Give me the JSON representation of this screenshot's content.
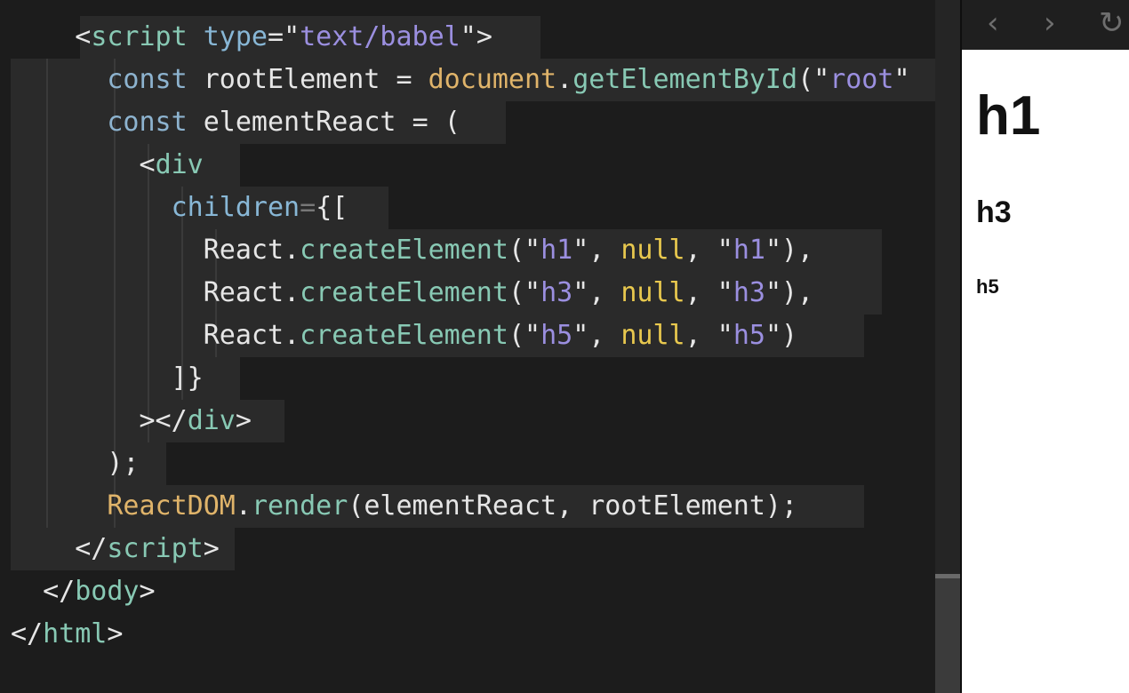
{
  "editor": {
    "lines": [
      {
        "indent": "    ",
        "tokens": [
          [
            "t-punc",
            "<"
          ],
          [
            "t-tag",
            "script"
          ],
          [
            "t-id",
            " "
          ],
          [
            "t-attr",
            "type"
          ],
          [
            "t-punc",
            "="
          ],
          [
            "t-punc",
            "\""
          ],
          [
            "t-str",
            "text/babel"
          ],
          [
            "t-punc",
            "\""
          ],
          [
            "t-punc",
            ">"
          ]
        ]
      },
      {
        "indent": "      ",
        "tokens": [
          [
            "t-kw",
            "const"
          ],
          [
            "t-id",
            " rootElement "
          ],
          [
            "t-punc",
            "="
          ],
          [
            "t-id",
            " "
          ],
          [
            "t-obj",
            "document"
          ],
          [
            "t-punc",
            "."
          ],
          [
            "t-fn",
            "getElementById"
          ],
          [
            "t-punc",
            "("
          ],
          [
            "t-punc",
            "\""
          ],
          [
            "t-str",
            "root"
          ],
          [
            "t-punc",
            "\""
          ]
        ]
      },
      {
        "indent": "      ",
        "tokens": [
          [
            "t-kw",
            "const"
          ],
          [
            "t-id",
            " elementReact "
          ],
          [
            "t-punc",
            "="
          ],
          [
            "t-id",
            " "
          ],
          [
            "t-punc",
            "("
          ]
        ]
      },
      {
        "indent": "        ",
        "tokens": [
          [
            "t-punc",
            "<"
          ],
          [
            "t-tag",
            "div"
          ]
        ]
      },
      {
        "indent": "          ",
        "tokens": [
          [
            "t-attr",
            "children"
          ],
          [
            "t-op",
            "="
          ],
          [
            "t-punc",
            "{["
          ]
        ]
      },
      {
        "indent": "            ",
        "tokens": [
          [
            "t-id",
            "React"
          ],
          [
            "t-punc",
            "."
          ],
          [
            "t-fn",
            "createElement"
          ],
          [
            "t-punc",
            "(\""
          ],
          [
            "t-str",
            "h1"
          ],
          [
            "t-punc",
            "\", "
          ],
          [
            "t-null",
            "null"
          ],
          [
            "t-punc",
            ", \""
          ],
          [
            "t-str",
            "h1"
          ],
          [
            "t-punc",
            "\"),"
          ]
        ]
      },
      {
        "indent": "            ",
        "tokens": [
          [
            "t-id",
            "React"
          ],
          [
            "t-punc",
            "."
          ],
          [
            "t-fn",
            "createElement"
          ],
          [
            "t-punc",
            "(\""
          ],
          [
            "t-str",
            "h3"
          ],
          [
            "t-punc",
            "\", "
          ],
          [
            "t-null",
            "null"
          ],
          [
            "t-punc",
            ", \""
          ],
          [
            "t-str",
            "h3"
          ],
          [
            "t-punc",
            "\"),"
          ]
        ]
      },
      {
        "indent": "            ",
        "tokens": [
          [
            "t-id",
            "React"
          ],
          [
            "t-punc",
            "."
          ],
          [
            "t-fn",
            "createElement"
          ],
          [
            "t-punc",
            "(\""
          ],
          [
            "t-str",
            "h5"
          ],
          [
            "t-punc",
            "\", "
          ],
          [
            "t-null",
            "null"
          ],
          [
            "t-punc",
            ", \""
          ],
          [
            "t-str",
            "h5"
          ],
          [
            "t-punc",
            "\")"
          ]
        ]
      },
      {
        "indent": "          ",
        "tokens": [
          [
            "t-punc",
            "]}"
          ]
        ]
      },
      {
        "indent": "        ",
        "tokens": [
          [
            "t-punc",
            "></"
          ],
          [
            "t-tag",
            "div"
          ],
          [
            "t-punc",
            ">"
          ]
        ]
      },
      {
        "indent": "      ",
        "tokens": [
          [
            "t-punc",
            ");"
          ]
        ]
      },
      {
        "indent": "      ",
        "tokens": [
          [
            "t-obj",
            "ReactDOM"
          ],
          [
            "t-punc",
            "."
          ],
          [
            "t-fn",
            "render"
          ],
          [
            "t-punc",
            "("
          ],
          [
            "t-id",
            "elementReact, rootElement"
          ],
          [
            "t-punc",
            ");"
          ]
        ]
      },
      {
        "indent": "    ",
        "tokens": [
          [
            "t-punc",
            "</"
          ],
          [
            "t-tag",
            "script"
          ],
          [
            "t-punc",
            ">"
          ]
        ]
      },
      {
        "indent": "  ",
        "tokens": [
          [
            "t-punc",
            "</"
          ],
          [
            "t-tag",
            "body"
          ],
          [
            "t-punc",
            ">"
          ]
        ]
      },
      {
        "indent": "",
        "tokens": [
          [
            "t-punc",
            "</"
          ],
          [
            "t-tag",
            "html"
          ],
          [
            "t-punc",
            ">"
          ]
        ]
      }
    ]
  },
  "browser": {
    "back_icon": "‹",
    "forward_icon": "›",
    "reload_icon": "↻",
    "h1": "h1",
    "h3": "h3",
    "h5": "h5"
  }
}
